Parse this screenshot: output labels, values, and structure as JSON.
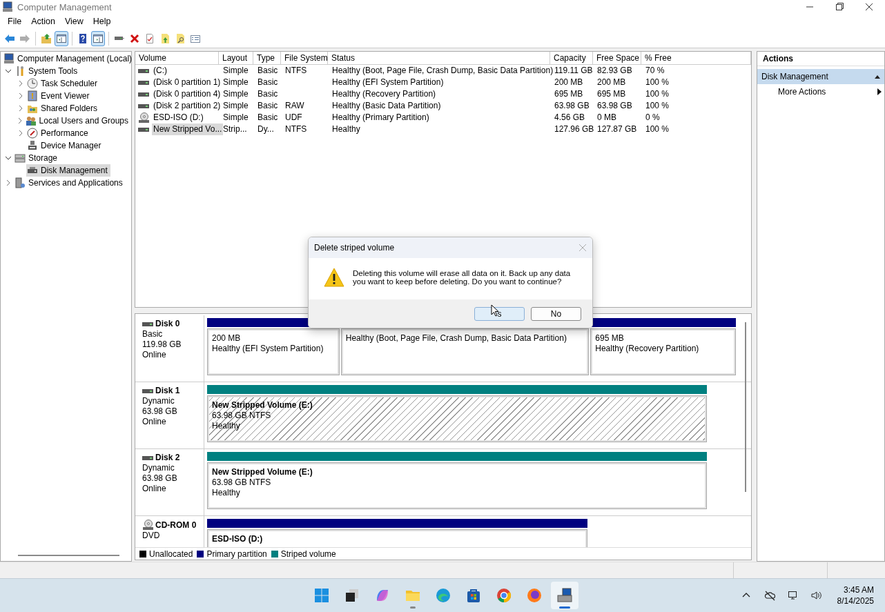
{
  "window": {
    "title": "Computer Management"
  },
  "menu": [
    "File",
    "Action",
    "View",
    "Help"
  ],
  "toolbar": [
    {
      "kind": "back",
      "disabled": false,
      "pressed": false
    },
    {
      "kind": "forward",
      "disabled": true,
      "pressed": false
    },
    {
      "kind": "up-folder",
      "disabled": false,
      "pressed": false
    },
    {
      "kind": "console-tree",
      "disabled": false,
      "pressed": true
    },
    {
      "kind": "help",
      "disabled": false,
      "pressed": false
    },
    {
      "kind": "action-pane",
      "disabled": false,
      "pressed": true
    },
    {
      "kind": "drive",
      "disabled": false,
      "pressed": false
    },
    {
      "kind": "delete",
      "disabled": false,
      "pressed": false
    },
    {
      "kind": "properties",
      "disabled": false,
      "pressed": false
    },
    {
      "kind": "folder-up",
      "disabled": false,
      "pressed": false
    },
    {
      "kind": "folder-search",
      "disabled": false,
      "pressed": false
    },
    {
      "kind": "list",
      "disabled": false,
      "pressed": false
    }
  ],
  "tree": [
    {
      "label": "Computer Management (Local)",
      "kind": "computer",
      "selected": false,
      "children": [
        {
          "label": "System Tools",
          "kind": "tools",
          "expanded": true,
          "selected": false,
          "children": [
            {
              "label": "Task Scheduler",
              "kind": "clock",
              "expanded": false,
              "selected": false
            },
            {
              "label": "Event Viewer",
              "kind": "event-log",
              "expanded": false,
              "selected": false
            },
            {
              "label": "Shared Folders",
              "kind": "shared-folder",
              "expanded": false,
              "selected": false
            },
            {
              "label": "Local Users and Groups",
              "kind": "users",
              "expanded": false,
              "selected": false
            },
            {
              "label": "Performance",
              "kind": "performance",
              "expanded": false,
              "selected": false
            },
            {
              "label": "Device Manager",
              "kind": "device",
              "selected": false
            }
          ]
        },
        {
          "label": "Storage",
          "kind": "storage",
          "expanded": true,
          "selected": false,
          "children": [
            {
              "label": "Disk Management",
              "kind": "disk",
              "selected": true
            }
          ]
        },
        {
          "label": "Services and Applications",
          "kind": "services",
          "expanded": false,
          "selected": false
        }
      ]
    }
  ],
  "volumes": {
    "columns": [
      "Volume",
      "Layout",
      "Type",
      "File System",
      "Status",
      "Capacity",
      "Free Space",
      "% Free"
    ],
    "rows": [
      {
        "kind": "hdd",
        "selected": false,
        "cells": [
          " (C:)",
          "Simple",
          "Basic",
          "NTFS",
          "Healthy (Boot, Page File, Crash Dump, Basic Data Partition)",
          "119.11 GB",
          "82.93 GB",
          "70 %"
        ]
      },
      {
        "kind": "hdd",
        "selected": false,
        "cells": [
          "(Disk 0 partition 1)",
          "Simple",
          "Basic",
          "",
          "Healthy (EFI System Partition)",
          "200 MB",
          "200 MB",
          "100 %"
        ]
      },
      {
        "kind": "hdd",
        "selected": false,
        "cells": [
          "(Disk 0 partition 4)",
          "Simple",
          "Basic",
          "",
          "Healthy (Recovery Partition)",
          "695 MB",
          "695 MB",
          "100 %"
        ]
      },
      {
        "kind": "hdd",
        "selected": false,
        "cells": [
          "(Disk 2 partition 2)",
          "Simple",
          "Basic",
          "RAW",
          "Healthy (Basic Data Partition)",
          "63.98 GB",
          "63.98 GB",
          "100 %"
        ]
      },
      {
        "kind": "cd",
        "selected": false,
        "cells": [
          "ESD-ISO (D:)",
          "Simple",
          "Basic",
          "UDF",
          "Healthy (Primary Partition)",
          "4.56 GB",
          "0 MB",
          "0 %"
        ]
      },
      {
        "kind": "hdd",
        "selected": true,
        "cells": [
          "New Stripped Vo...",
          "Strip...",
          "Dy...",
          "NTFS",
          "Healthy",
          "127.96 GB",
          "127.87 GB",
          "100 %"
        ]
      }
    ]
  },
  "disks": [
    {
      "name": "Disk 0",
      "kind": "hdd",
      "type": "Basic",
      "size": "119.98 GB",
      "status": "Online",
      "partitions": [
        {
          "color": "#000080",
          "selected": false,
          "lines": [
            "200 MB",
            "Healthy (EFI System Partition)"
          ]
        },
        {
          "selected": false,
          "lines": [
            "Healthy (Boot, Page File, Crash Dump, Basic Data Partition)"
          ]
        },
        {
          "color": "#000080",
          "selected": false,
          "lines": [
            "695 MB",
            "Healthy (Recovery Partition)"
          ]
        }
      ]
    },
    {
      "name": "Disk 1",
      "kind": "hdd",
      "type": "Dynamic",
      "size": "63.98 GB",
      "status": "Online",
      "partitions": [
        {
          "color": "#008080",
          "selected": true,
          "title": "New Stripped Volume  (E:)",
          "lines": [
            "63.98 GB NTFS",
            "Healthy"
          ]
        }
      ]
    },
    {
      "name": "Disk 2",
      "kind": "hdd",
      "type": "Dynamic",
      "size": "63.98 GB",
      "status": "Online",
      "partitions": [
        {
          "color": "#008080",
          "selected": false,
          "title": "New Stripped Volume  (E:)",
          "lines": [
            "63.98 GB NTFS",
            "Healthy"
          ]
        }
      ]
    },
    {
      "name": "CD-ROM 0",
      "kind": "cd",
      "type": "DVD",
      "partitions": [
        {
          "color": "#000080",
          "selected": false,
          "title": "ESD-ISO  (D:)"
        }
      ]
    }
  ],
  "legend": [
    {
      "label": "Unallocated",
      "color": "#000000"
    },
    {
      "label": "Primary partition",
      "color": "#000080"
    },
    {
      "label": "Striped volume",
      "color": "#008080"
    }
  ],
  "actions": {
    "title": "Actions",
    "groups": [
      {
        "label": "Disk Management",
        "selected": true,
        "items": [
          "More Actions"
        ]
      }
    ]
  },
  "dialog": {
    "title": "Delete striped volume",
    "message": "Deleting this volume will erase all data on it. Back up any data you want to keep before deleting. Do you want to continue?",
    "buttons": [
      {
        "label": "s",
        "hovered": true
      },
      {
        "label": "No",
        "hovered": false
      }
    ]
  },
  "taskbar": {
    "apps": [
      {
        "kind": "start",
        "running": false,
        "active": false
      },
      {
        "kind": "task-view",
        "running": false,
        "active": false
      },
      {
        "kind": "copilot",
        "running": false,
        "active": false
      },
      {
        "kind": "explorer",
        "running": true,
        "active": false
      },
      {
        "kind": "edge",
        "running": false,
        "active": false
      },
      {
        "kind": "store",
        "running": false,
        "active": false
      },
      {
        "kind": "chrome",
        "running": false,
        "active": false
      },
      {
        "kind": "firefox",
        "running": false,
        "active": false
      },
      {
        "kind": "computer-management",
        "running": true,
        "active": true
      }
    ],
    "tray": [
      {
        "kind": "chevron"
      },
      {
        "kind": "cloud-off"
      },
      {
        "kind": "network"
      },
      {
        "kind": "volume"
      }
    ],
    "time": "3:45 AM",
    "date": "8/14/2025"
  }
}
